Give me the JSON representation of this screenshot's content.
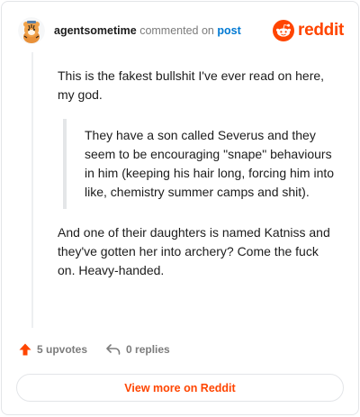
{
  "header": {
    "username": "agentsometime",
    "action_text": "commented on",
    "post_link": "post",
    "brand": "reddit"
  },
  "comment": {
    "paragraph_1": "This is the fakest bullshit I've ever read on here, my god.",
    "quote": "They have a son called Severus and they seem to be encouraging \"snape\" behaviours in him (keeping his hair long, forcing him into like, chemistry summer camps and shit).",
    "paragraph_2": "And one of their daughters is named Katniss and they've gotten her into archery? Come the fuck on. Heavy-handed."
  },
  "actions": {
    "upvotes": "5 upvotes",
    "replies": "0 replies"
  },
  "footer": {
    "view_more": "View more on Reddit"
  },
  "colors": {
    "brand_orange": "#ff4500",
    "link_blue": "#0079d3",
    "muted_gray": "#7c7c7c"
  }
}
